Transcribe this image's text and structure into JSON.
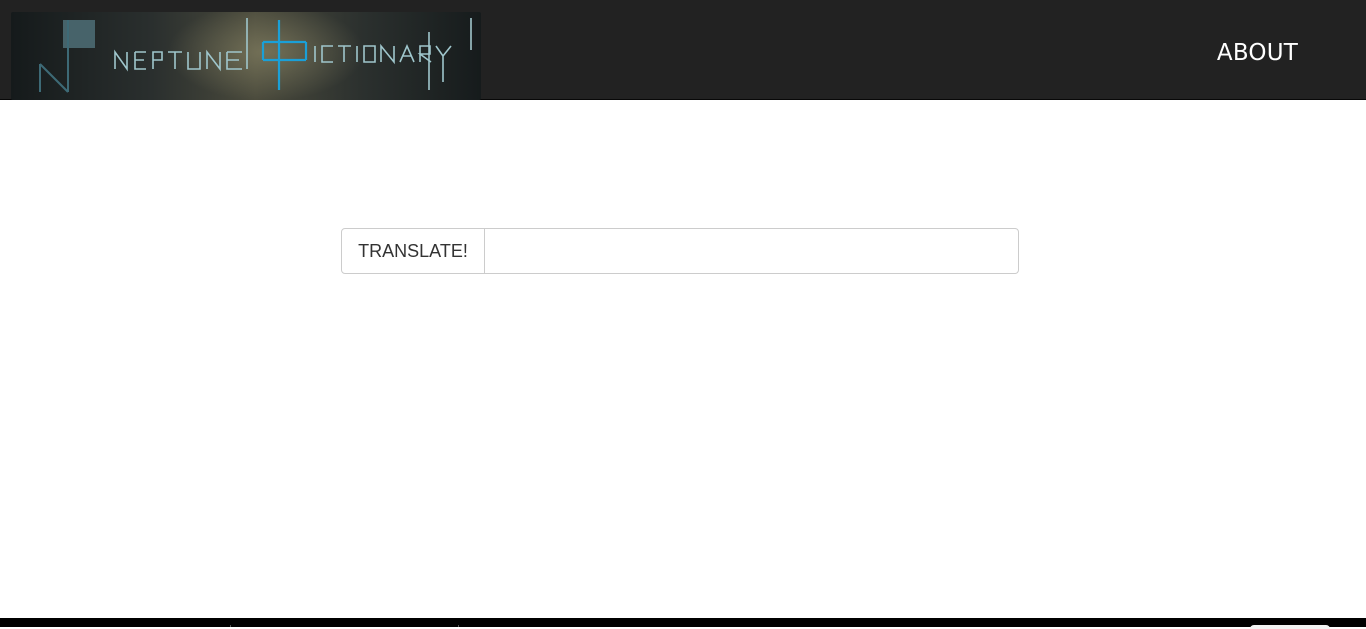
{
  "navbar": {
    "logo": {
      "alt": "Neptune Dictionary",
      "text": "NEPTUNE DICTIONARY"
    },
    "about_label": "ABOUT"
  },
  "translate": {
    "button_label": "TRANSLATE!",
    "input_value": "",
    "input_placeholder": ""
  },
  "colors": {
    "navbar_bg": "#222222",
    "logo_accent": "#1aa0d8",
    "logo_text": "#9fc6cc",
    "footer_bg": "#000000"
  }
}
